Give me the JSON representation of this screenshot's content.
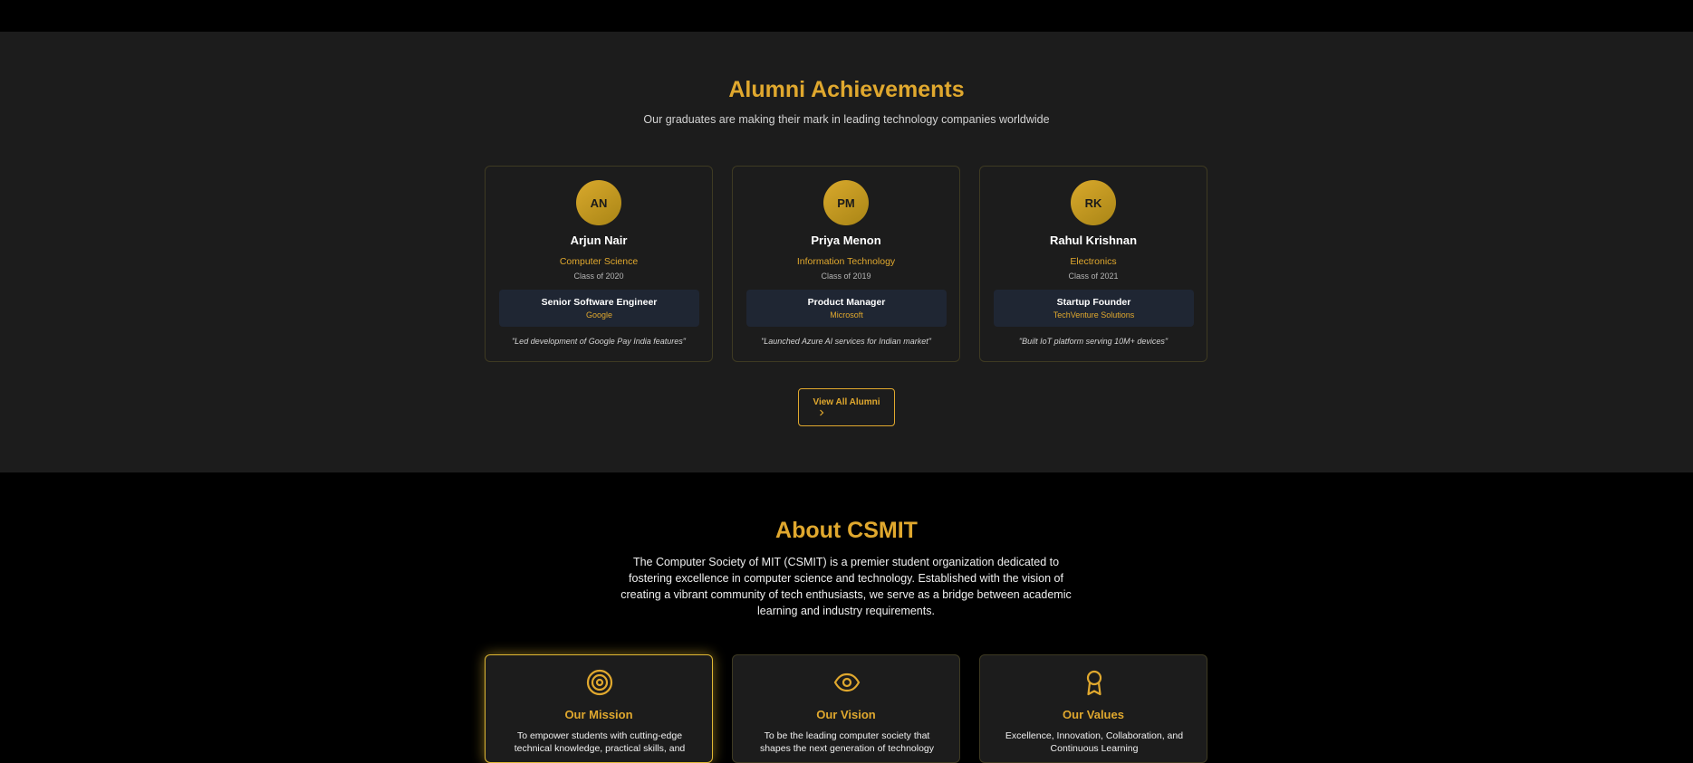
{
  "alumni": {
    "title": "Alumni Achievements",
    "subtitle": "Our graduates are making their mark in leading technology companies worldwide",
    "cards": [
      {
        "initials": "AN",
        "name": "Arjun Nair",
        "dept": "Computer Science",
        "class_year": "Class of 2020",
        "role": "Senior Software Engineer",
        "company": "Google",
        "quote": "\"Led development of Google Pay India features\""
      },
      {
        "initials": "PM",
        "name": "Priya Menon",
        "dept": "Information Technology",
        "class_year": "Class of 2019",
        "role": "Product Manager",
        "company": "Microsoft",
        "quote": "\"Launched Azure AI services for Indian market\""
      },
      {
        "initials": "RK",
        "name": "Rahul Krishnan",
        "dept": "Electronics",
        "class_year": "Class of 2021",
        "role": "Startup Founder",
        "company": "TechVenture Solutions",
        "quote": "\"Built IoT platform serving 10M+ devices\""
      }
    ],
    "view_all_label": "View All Alumni",
    "view_all_icon": "chevron-right-icon"
  },
  "about": {
    "title": "About CSMIT",
    "text": "The Computer Society of MIT (CSMIT) is a premier student organization dedicated to fostering excellence in computer science and technology. Established with the vision of creating a vibrant community of tech enthusiasts, we serve as a bridge between academic learning and industry requirements.",
    "cards": [
      {
        "icon": "target-icon",
        "title": "Our Mission",
        "text": "To empower students with cutting-edge technical knowledge, practical skills, and"
      },
      {
        "icon": "eye-icon",
        "title": "Our Vision",
        "text": "To be the leading computer society that shapes the next generation of technology"
      },
      {
        "icon": "award-icon",
        "title": "Our Values",
        "text": "Excellence, Innovation, Collaboration, and Continuous Learning"
      }
    ]
  },
  "colors": {
    "accent": "#e0a82e",
    "section_bg": "#1c1c1c",
    "page_bg": "#000000",
    "role_box_bg": "#1f2633"
  }
}
